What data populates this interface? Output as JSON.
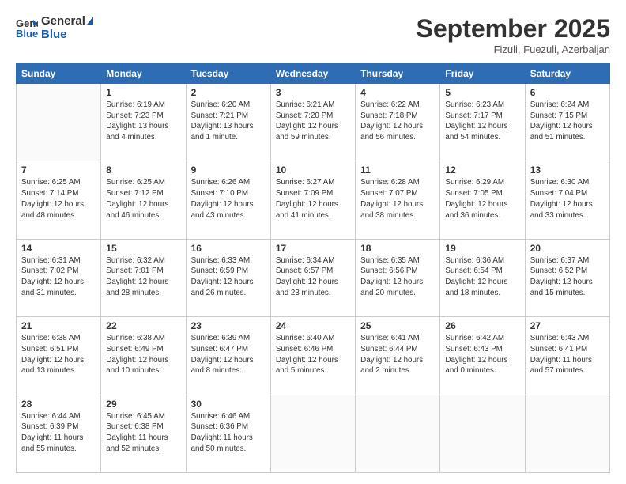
{
  "logo": {
    "line1": "General",
    "line2": "Blue"
  },
  "title": "September 2025",
  "location": "Fizuli, Fuezuli, Azerbaijan",
  "days_header": [
    "Sunday",
    "Monday",
    "Tuesday",
    "Wednesday",
    "Thursday",
    "Friday",
    "Saturday"
  ],
  "weeks": [
    [
      {
        "day": "",
        "info": ""
      },
      {
        "day": "1",
        "info": "Sunrise: 6:19 AM\nSunset: 7:23 PM\nDaylight: 13 hours\nand 4 minutes."
      },
      {
        "day": "2",
        "info": "Sunrise: 6:20 AM\nSunset: 7:21 PM\nDaylight: 13 hours\nand 1 minute."
      },
      {
        "day": "3",
        "info": "Sunrise: 6:21 AM\nSunset: 7:20 PM\nDaylight: 12 hours\nand 59 minutes."
      },
      {
        "day": "4",
        "info": "Sunrise: 6:22 AM\nSunset: 7:18 PM\nDaylight: 12 hours\nand 56 minutes."
      },
      {
        "day": "5",
        "info": "Sunrise: 6:23 AM\nSunset: 7:17 PM\nDaylight: 12 hours\nand 54 minutes."
      },
      {
        "day": "6",
        "info": "Sunrise: 6:24 AM\nSunset: 7:15 PM\nDaylight: 12 hours\nand 51 minutes."
      }
    ],
    [
      {
        "day": "7",
        "info": "Sunrise: 6:25 AM\nSunset: 7:14 PM\nDaylight: 12 hours\nand 48 minutes."
      },
      {
        "day": "8",
        "info": "Sunrise: 6:25 AM\nSunset: 7:12 PM\nDaylight: 12 hours\nand 46 minutes."
      },
      {
        "day": "9",
        "info": "Sunrise: 6:26 AM\nSunset: 7:10 PM\nDaylight: 12 hours\nand 43 minutes."
      },
      {
        "day": "10",
        "info": "Sunrise: 6:27 AM\nSunset: 7:09 PM\nDaylight: 12 hours\nand 41 minutes."
      },
      {
        "day": "11",
        "info": "Sunrise: 6:28 AM\nSunset: 7:07 PM\nDaylight: 12 hours\nand 38 minutes."
      },
      {
        "day": "12",
        "info": "Sunrise: 6:29 AM\nSunset: 7:05 PM\nDaylight: 12 hours\nand 36 minutes."
      },
      {
        "day": "13",
        "info": "Sunrise: 6:30 AM\nSunset: 7:04 PM\nDaylight: 12 hours\nand 33 minutes."
      }
    ],
    [
      {
        "day": "14",
        "info": "Sunrise: 6:31 AM\nSunset: 7:02 PM\nDaylight: 12 hours\nand 31 minutes."
      },
      {
        "day": "15",
        "info": "Sunrise: 6:32 AM\nSunset: 7:01 PM\nDaylight: 12 hours\nand 28 minutes."
      },
      {
        "day": "16",
        "info": "Sunrise: 6:33 AM\nSunset: 6:59 PM\nDaylight: 12 hours\nand 26 minutes."
      },
      {
        "day": "17",
        "info": "Sunrise: 6:34 AM\nSunset: 6:57 PM\nDaylight: 12 hours\nand 23 minutes."
      },
      {
        "day": "18",
        "info": "Sunrise: 6:35 AM\nSunset: 6:56 PM\nDaylight: 12 hours\nand 20 minutes."
      },
      {
        "day": "19",
        "info": "Sunrise: 6:36 AM\nSunset: 6:54 PM\nDaylight: 12 hours\nand 18 minutes."
      },
      {
        "day": "20",
        "info": "Sunrise: 6:37 AM\nSunset: 6:52 PM\nDaylight: 12 hours\nand 15 minutes."
      }
    ],
    [
      {
        "day": "21",
        "info": "Sunrise: 6:38 AM\nSunset: 6:51 PM\nDaylight: 12 hours\nand 13 minutes."
      },
      {
        "day": "22",
        "info": "Sunrise: 6:38 AM\nSunset: 6:49 PM\nDaylight: 12 hours\nand 10 minutes."
      },
      {
        "day": "23",
        "info": "Sunrise: 6:39 AM\nSunset: 6:47 PM\nDaylight: 12 hours\nand 8 minutes."
      },
      {
        "day": "24",
        "info": "Sunrise: 6:40 AM\nSunset: 6:46 PM\nDaylight: 12 hours\nand 5 minutes."
      },
      {
        "day": "25",
        "info": "Sunrise: 6:41 AM\nSunset: 6:44 PM\nDaylight: 12 hours\nand 2 minutes."
      },
      {
        "day": "26",
        "info": "Sunrise: 6:42 AM\nSunset: 6:43 PM\nDaylight: 12 hours\nand 0 minutes."
      },
      {
        "day": "27",
        "info": "Sunrise: 6:43 AM\nSunset: 6:41 PM\nDaylight: 11 hours\nand 57 minutes."
      }
    ],
    [
      {
        "day": "28",
        "info": "Sunrise: 6:44 AM\nSunset: 6:39 PM\nDaylight: 11 hours\nand 55 minutes."
      },
      {
        "day": "29",
        "info": "Sunrise: 6:45 AM\nSunset: 6:38 PM\nDaylight: 11 hours\nand 52 minutes."
      },
      {
        "day": "30",
        "info": "Sunrise: 6:46 AM\nSunset: 6:36 PM\nDaylight: 11 hours\nand 50 minutes."
      },
      {
        "day": "",
        "info": ""
      },
      {
        "day": "",
        "info": ""
      },
      {
        "day": "",
        "info": ""
      },
      {
        "day": "",
        "info": ""
      }
    ]
  ]
}
